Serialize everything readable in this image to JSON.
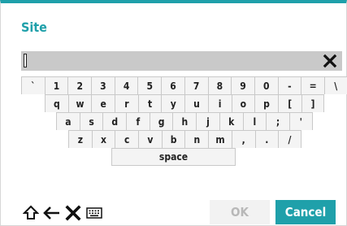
{
  "dialog": {
    "title": "Site",
    "accent_color": "#1fa0aa"
  },
  "input": {
    "value": ""
  },
  "keyboard": {
    "row1": [
      "`",
      "1",
      "2",
      "3",
      "4",
      "5",
      "6",
      "7",
      "8",
      "9",
      "0",
      "-",
      "=",
      "\\"
    ],
    "row2": [
      "q",
      "w",
      "e",
      "r",
      "t",
      "y",
      "u",
      "i",
      "o",
      "p",
      "[",
      "]"
    ],
    "row3": [
      "a",
      "s",
      "d",
      "f",
      "g",
      "h",
      "j",
      "k",
      "l",
      ";",
      "'"
    ],
    "row4": [
      "z",
      "x",
      "c",
      "v",
      "b",
      "n",
      "m",
      ",",
      ".",
      "/"
    ],
    "space_label": "space"
  },
  "toolbar": {
    "icons": [
      "shift-icon",
      "backspace-icon",
      "clear-all-icon",
      "keyboard-icon"
    ]
  },
  "buttons": {
    "ok_label": "OK",
    "cancel_label": "Cancel"
  }
}
